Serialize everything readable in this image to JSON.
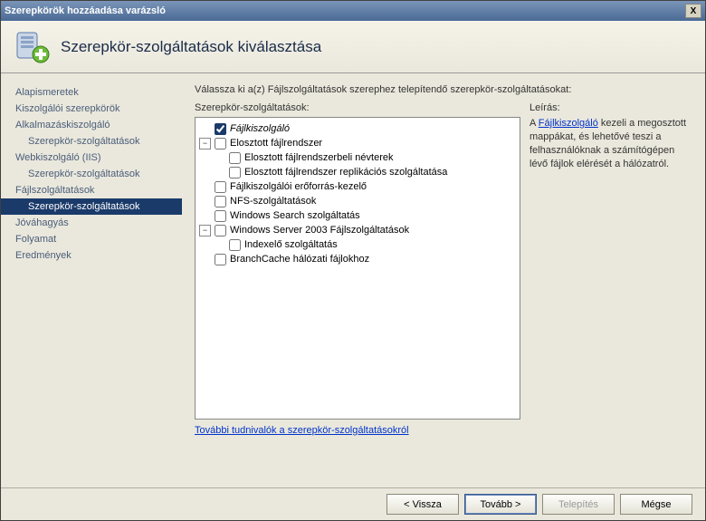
{
  "titlebar": {
    "title": "Szerepkörök hozzáadása varázsló",
    "close": "X"
  },
  "header": {
    "title": "Szerepkör-szolgáltatások kiválasztása"
  },
  "nav": {
    "items": [
      {
        "label": "Alapismeretek",
        "cls": ""
      },
      {
        "label": "Kiszolgálói szerepkörök",
        "cls": ""
      },
      {
        "label": "Alkalmazáskiszolgáló",
        "cls": ""
      },
      {
        "label": "Szerepkör-szolgáltatások",
        "cls": "sub"
      },
      {
        "label": "Webkiszolgáló (IIS)",
        "cls": ""
      },
      {
        "label": "Szerepkör-szolgáltatások",
        "cls": "sub"
      },
      {
        "label": "Fájlszolgáltatások",
        "cls": ""
      },
      {
        "label": "Szerepkör-szolgáltatások",
        "cls": "sub selected"
      },
      {
        "label": "Jóváhagyás",
        "cls": ""
      },
      {
        "label": "Folyamat",
        "cls": ""
      },
      {
        "label": "Eredmények",
        "cls": ""
      }
    ]
  },
  "content": {
    "instruction": "Válassza ki a(z) Fájlszolgáltatások szerephez telepítendő szerepkör-szolgáltatásokat:",
    "tree_label": "Szerepkör-szolgáltatások:",
    "desc_label": "Leírás:",
    "desc_prefix": "A ",
    "desc_link": "Fájlkiszolgáló",
    "desc_rest": " kezeli a megosztott mappákat, és lehetővé teszi a felhasználóknak a számítógépen lévő fájlok elérését a hálózatról.",
    "more_link": "További tudnivalók a szerepkör-szolgáltatásokról",
    "tree": [
      {
        "indent": 0,
        "exp": "none",
        "checked": true,
        "italic": true,
        "label": "Fájlkiszolgáló"
      },
      {
        "indent": 0,
        "exp": "minus",
        "checked": false,
        "italic": false,
        "label": "Elosztott fájlrendszer"
      },
      {
        "indent": 1,
        "exp": "none",
        "checked": false,
        "italic": false,
        "label": "Elosztott fájlrendszerbeli névterek"
      },
      {
        "indent": 1,
        "exp": "none",
        "checked": false,
        "italic": false,
        "label": "Elosztott fájlrendszer replikációs szolgáltatása"
      },
      {
        "indent": 0,
        "exp": "none",
        "checked": false,
        "italic": false,
        "label": "Fájlkiszolgálói erőforrás-kezelő"
      },
      {
        "indent": 0,
        "exp": "none",
        "checked": false,
        "italic": false,
        "label": "NFS-szolgáltatások"
      },
      {
        "indent": 0,
        "exp": "none",
        "checked": false,
        "italic": false,
        "label": "Windows Search szolgáltatás"
      },
      {
        "indent": 0,
        "exp": "minus",
        "checked": false,
        "italic": false,
        "label": "Windows Server 2003 Fájlszolgáltatások"
      },
      {
        "indent": 1,
        "exp": "none",
        "checked": false,
        "italic": false,
        "label": "Indexelő szolgáltatás"
      },
      {
        "indent": 0,
        "exp": "none",
        "checked": false,
        "italic": false,
        "label": "BranchCache hálózati fájlokhoz"
      }
    ]
  },
  "footer": {
    "prev": "< Vissza",
    "next": "Tovább >",
    "install": "Telepítés",
    "cancel": "Mégse"
  }
}
